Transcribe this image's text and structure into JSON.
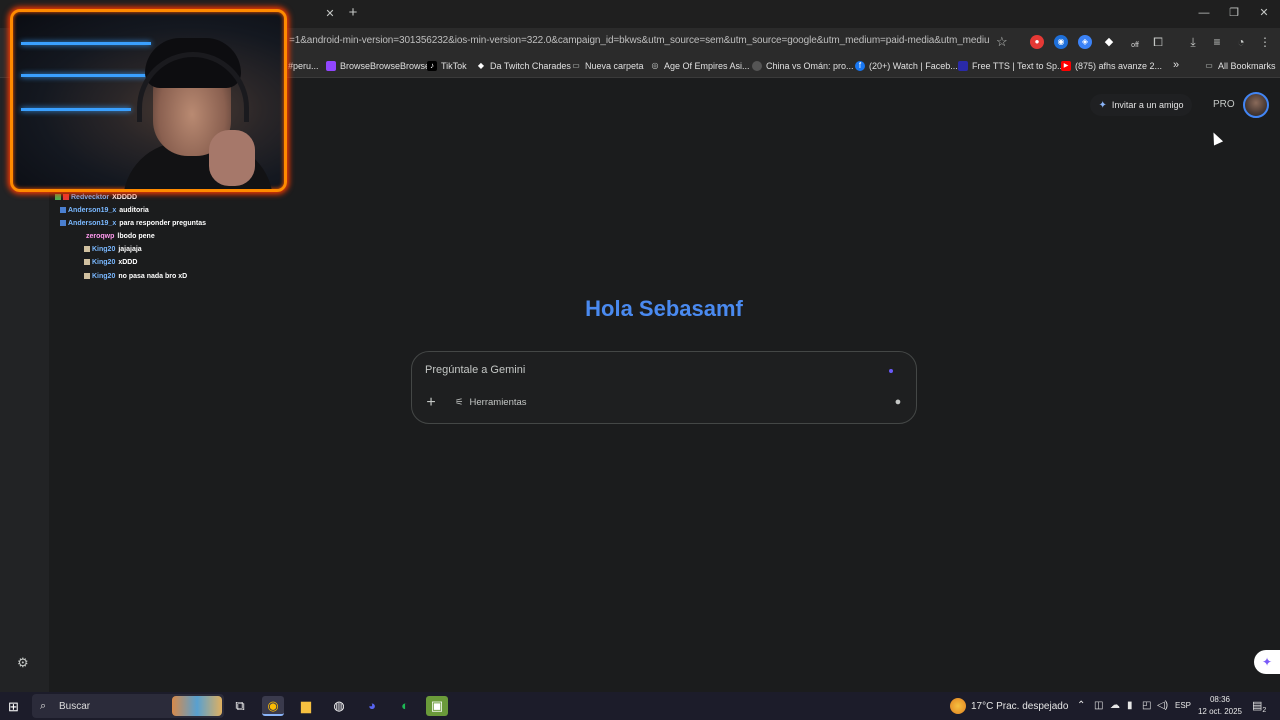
{
  "browser": {
    "url": "=1&android-min-version=301356232&ios-min-version=322.0&campaign_id=bkws&utm_source=sem&utm_source=google&utm_medium=paid-media&utm_medium=...",
    "tab_close_glyph": "✕",
    "new_tab_glyph": "+",
    "window_controls": [
      "—",
      "❐",
      "✕"
    ],
    "extensions": [
      {
        "name": "red-extension-icon",
        "color": "#e53935",
        "glyph": "●"
      },
      {
        "name": "blue-extension-icon",
        "color": "#1e6fd9",
        "glyph": "◉"
      },
      {
        "name": "shield-extension-icon",
        "color": "#3b82f6",
        "glyph": "◈"
      },
      {
        "name": "diamond-extension-icon",
        "color": "#ffffff",
        "glyph": "◆"
      },
      {
        "name": "off-extension-icon",
        "color": "#9e9e9e",
        "glyph": "off"
      }
    ]
  },
  "bookmarks": [
    {
      "label": "#peru...",
      "icon": "●"
    },
    {
      "label": "BrowseBrowseBrowse",
      "icon": "▪"
    },
    {
      "label": "TikTok",
      "icon": "♪"
    },
    {
      "label": "Da Twitch Charades",
      "icon": "◆"
    },
    {
      "label": "Nueva carpeta",
      "icon": "▭"
    },
    {
      "label": "Age Of Empires Asi...",
      "icon": "◎"
    },
    {
      "label": "China vs Omán: pro...",
      "icon": "●"
    },
    {
      "label": "(20+) Watch | Faceb...",
      "icon": "f"
    },
    {
      "label": "Free TTS | Text to Sp...",
      "icon": "▪"
    },
    {
      "label": "(875) afhs avanze 2...",
      "icon": "▶"
    }
  ],
  "bookmarks_overflow": "»",
  "all_bookmarks": "All Bookmarks",
  "chat": [
    {
      "user": "Redvecktor",
      "msg": "XDDDD",
      "pink": false
    },
    {
      "user": "Anderson19_x",
      "msg": "auditoria",
      "pink": false
    },
    {
      "user": "Anderson19_x",
      "msg": "para responder preguntas",
      "pink": false
    },
    {
      "user": "zeroqwp",
      "msg": "lbodo pene",
      "pink": true
    },
    {
      "user": "King20",
      "msg": "jajajaja",
      "pink": false
    },
    {
      "user": "King20",
      "msg": "xDDD",
      "pink": false
    },
    {
      "user": "King20",
      "msg": "no pasa nada bro xD",
      "pink": false
    }
  ],
  "gemini": {
    "invite_label": "Invitar a un amigo",
    "pro_label": "PRO",
    "greeting": "Hola Sebasamf",
    "prompt_placeholder": "Pregúntale a Gemini",
    "plus_glyph": "+",
    "tools_label": "Herramientas",
    "tools_glyph": "⚟",
    "mic_glyph": "🎙",
    "settings_glyph": "⚙",
    "float_glyph": "✦",
    "invite_glyph": "✦"
  },
  "taskbar": {
    "start_glyph": "⊞",
    "search_label": "Buscar",
    "search_glyph": "⌕",
    "apps": [
      {
        "name": "task-view-icon",
        "glyph": "⧉",
        "active": false
      },
      {
        "name": "chrome-icon",
        "glyph": "◉",
        "active": true
      },
      {
        "name": "file-explorer-icon",
        "glyph": "▆",
        "active": false
      },
      {
        "name": "obs-icon",
        "glyph": "◍",
        "active": false
      },
      {
        "name": "discord-icon",
        "glyph": "◕",
        "active": false
      },
      {
        "name": "spotify-icon",
        "glyph": "◐",
        "active": false
      },
      {
        "name": "minecraft-icon",
        "glyph": "▣",
        "active": false
      }
    ],
    "weather": "17°C  Prac. despejado",
    "language": "ESP",
    "time": "08:36",
    "date": "12 oct. 2025",
    "notifications_count": "2"
  }
}
